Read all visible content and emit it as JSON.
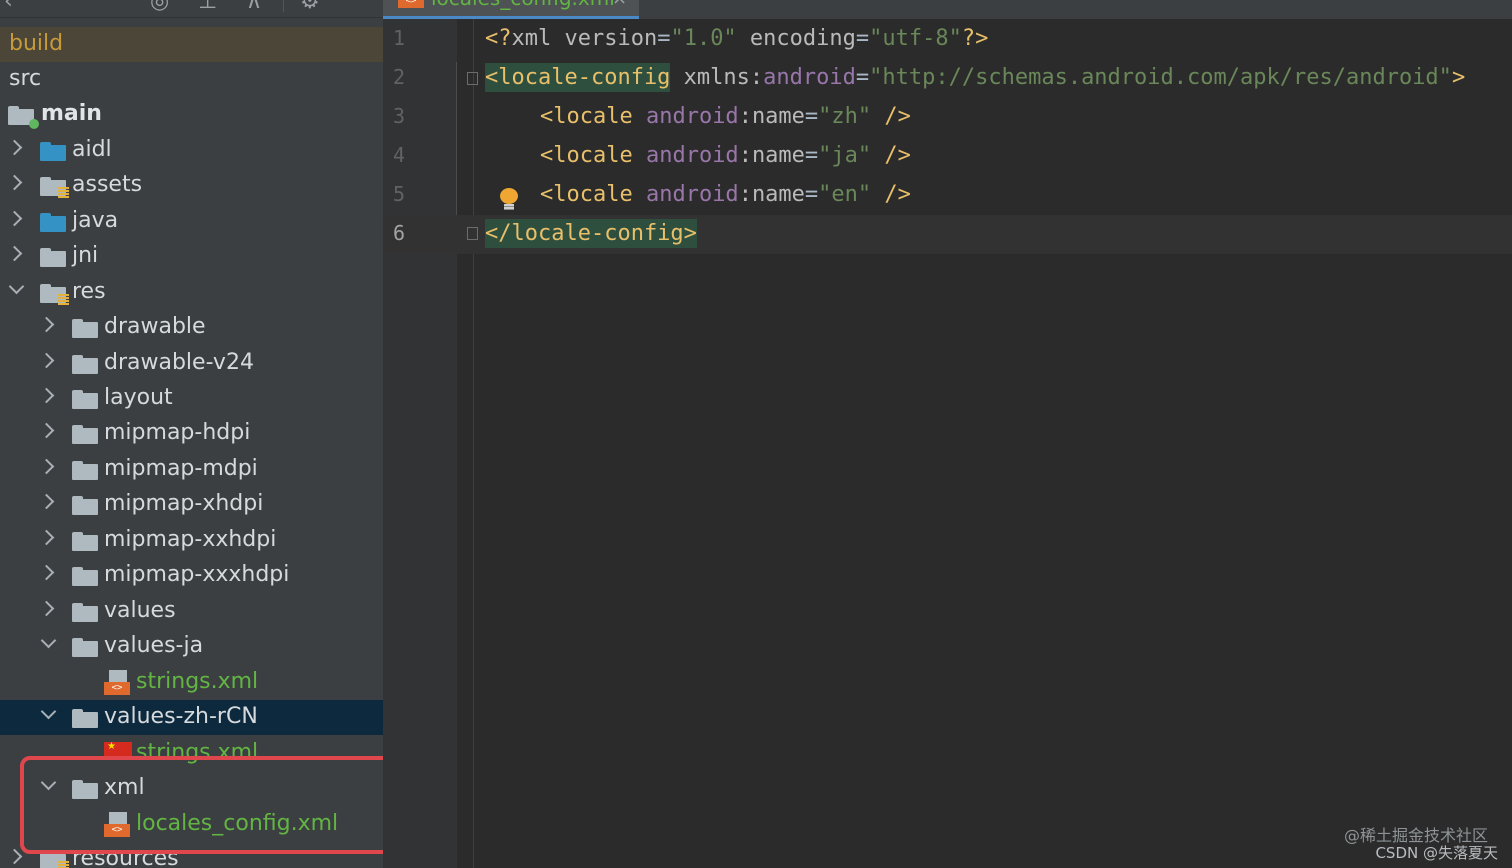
{
  "sidebar": {
    "build_label": "build",
    "src_label": "src",
    "main_label": "main",
    "items": {
      "aidl": "aidl",
      "assets": "assets",
      "java": "java",
      "jni": "jni",
      "res": "res",
      "drawable": "drawable",
      "drawable_v24": "drawable-v24",
      "layout": "layout",
      "mipmap_hdpi": "mipmap-hdpi",
      "mipmap_mdpi": "mipmap-mdpi",
      "mipmap_xhdpi": "mipmap-xhdpi",
      "mipmap_xxhdpi": "mipmap-xxhdpi",
      "mipmap_xxxhdpi": "mipmap-xxxhdpi",
      "values": "values",
      "values_ja": "values-ja",
      "strings_xml_ja": "strings.xml",
      "values_zh_rcn": "values-zh-rCN",
      "strings_xml_zh": "strings.xml",
      "xml": "xml",
      "locales_config_xml": "locales_config.xml",
      "resources": "resources"
    },
    "xml_badge": "<>",
    "highlight_color": "#e0474c"
  },
  "editor": {
    "tab_label": "locales_config.xml",
    "tab_close": "×",
    "lines": [
      {
        "num": "1"
      },
      {
        "num": "2"
      },
      {
        "num": "3"
      },
      {
        "num": "4"
      },
      {
        "num": "5"
      },
      {
        "num": "6"
      }
    ],
    "tokens": {
      "l1_open": "<?",
      "l1_xml": "xml ",
      "l1_version": "version",
      "l1_eq": "=",
      "l1_version_val": "\"1.0\"",
      "l1_encoding": " encoding",
      "l1_encoding_val": "\"utf-8\"",
      "l1_close": "?>",
      "l2_tag": "<locale-config",
      "l2_xmlns": " xmlns",
      "l2_colon": ":",
      "l2_android": "android",
      "l2_url": "\"http://schemas.android.com/apk/res/android\"",
      "l2_gt": ">",
      "loc_tag": "<locale",
      "loc_android": " android",
      "loc_name": "name",
      "loc_zh": "\"zh\"",
      "loc_ja": "\"ja\"",
      "loc_en": "\"en\"",
      "loc_end": " />",
      "l6_tag": "</locale-config>"
    }
  },
  "watermark": {
    "line1": "@稀土掘金技术社区",
    "line2": "CSDN @失落夏天"
  },
  "colors": {
    "sidebar_bg": "#3c3f41",
    "editor_bg": "#2b2b2b",
    "selection": "#0d293e",
    "vcs_green": "#62b543",
    "xml_tag": "#e8bf6a",
    "xml_string": "#6a8759",
    "xml_namespace": "#9876aa"
  }
}
